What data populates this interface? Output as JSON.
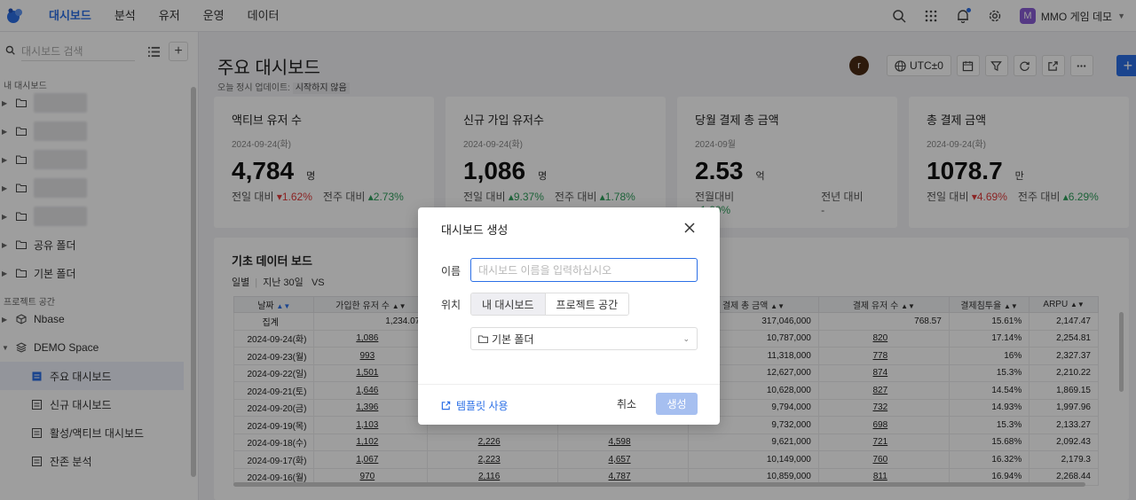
{
  "nav": {
    "items": [
      "대시보드",
      "분석",
      "유저",
      "운영",
      "데이터"
    ],
    "project_initial": "M",
    "project_name": "MMO 게임 데모"
  },
  "sidebar": {
    "search_placeholder": "대시보드 검색",
    "my_dashboards_label": "내 대시보드",
    "shared_folder": "공유 폴더",
    "default_folder": "기본 폴더",
    "project_space_label": "프로젝트 공간",
    "spaces": [
      "Nbase",
      "DEMO Space"
    ],
    "children": [
      "주요 대시보드",
      "신규 대시보드",
      "활성/액티브 대시보드",
      "잔존 분석"
    ]
  },
  "header": {
    "title": "주요 대시보드",
    "update_prefix": "오늘 정시 업데이트:",
    "update_state": "시작하지 않음",
    "user_initial": "r",
    "utc_label": "UTC±0"
  },
  "kpis": [
    {
      "title": "액티브 유저 수",
      "date": "2024-09-24(화)",
      "value": "4,784",
      "unit": "명",
      "cmp1_label": "전일 대비",
      "cmp1_value": "1.62%",
      "cmp2_label": "전주 대비",
      "cmp2_value": "2.73%"
    },
    {
      "title": "신규 가입 유저수",
      "date": "2024-09-24(화)",
      "value": "1,086",
      "unit": "명",
      "cmp1_label": "전일 대비",
      "cmp1_value": "9.37%",
      "cmp2_label": "전주 대비",
      "cmp2_value": "1.78%"
    },
    {
      "title": "당월 결제 총 금액",
      "date": "2024-09월",
      "value": "2.53",
      "unit": "억",
      "cmp1_label": "전월대비",
      "cmp1_value": "1.60%",
      "cmp2_label": "전년 대비",
      "cmp2_value": "-"
    },
    {
      "title": "총 결제 금액",
      "date": "2024-09-24(화)",
      "value": "1078.7",
      "unit": "만",
      "cmp1_label": "전일 대비",
      "cmp1_value": "4.69%",
      "cmp2_label": "전주 대비",
      "cmp2_value": "6.29%"
    }
  ],
  "board": {
    "title": "기초 데이터 보드",
    "granularity": "일별",
    "range": "지난 30일",
    "vs": "VS",
    "columns": [
      "날짜",
      "가입한 유저 수",
      "",
      "",
      "결제 총 금액",
      "결제 유저 수",
      "결제침투율",
      "ARPU"
    ],
    "summary": [
      "집계",
      "1,234.07",
      "",
      "",
      "317,046,000",
      "768.57",
      "15.61%",
      "2,147.47"
    ],
    "rows": [
      [
        "2024-09-24(화)",
        "1,086",
        "",
        "",
        "10,787,000",
        "820",
        "17.14%",
        "2,254.81"
      ],
      [
        "2024-09-23(월)",
        "993",
        "",
        "",
        "11,318,000",
        "778",
        "16%",
        "2,327.37"
      ],
      [
        "2024-09-22(일)",
        "1,501",
        "",
        "",
        "12,627,000",
        "874",
        "15.3%",
        "2,210.22"
      ],
      [
        "2024-09-21(토)",
        "1,646",
        "",
        "",
        "10,628,000",
        "827",
        "14.54%",
        "1,869.15"
      ],
      [
        "2024-09-20(금)",
        "1,396",
        "",
        "",
        "9,794,000",
        "732",
        "14.93%",
        "1,997.96"
      ],
      [
        "2024-09-19(목)",
        "1,103",
        "",
        "",
        "9,732,000",
        "698",
        "15.3%",
        "2,133.27"
      ],
      [
        "2024-09-18(수)",
        "1,102",
        "2,226",
        "4,598",
        "9,621,000",
        "721",
        "15.68%",
        "2,092.43"
      ],
      [
        "2024-09-17(화)",
        "1,067",
        "2,223",
        "4,657",
        "10,149,000",
        "760",
        "16.32%",
        "2,179.3"
      ],
      [
        "2024-09-16(월)",
        "970",
        "2,116",
        "4,787",
        "10,859,000",
        "811",
        "16.94%",
        "2,268.44"
      ]
    ]
  },
  "modal": {
    "title": "대시보드 생성",
    "name_label": "이름",
    "name_placeholder": "대시보드 이름을 입력하십시오",
    "location_label": "위치",
    "seg_my": "내 대시보드",
    "seg_project": "프로젝트 공간",
    "folder_value": "기본 폴더",
    "template_link": "템플릿 사용",
    "cancel": "취소",
    "create": "생성"
  },
  "colors": {
    "accent": "#2b6fe6",
    "up": "#2e9e5b",
    "down": "#e03b3b"
  }
}
